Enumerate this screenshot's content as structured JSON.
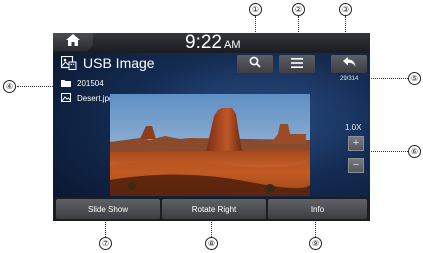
{
  "status_bar": {
    "time": "9:22",
    "ampm": "AM"
  },
  "header": {
    "title": "USB Image",
    "photo_count": "29/314"
  },
  "files": [
    {
      "type": "folder",
      "name": "201504"
    },
    {
      "type": "image",
      "name": "Desert.jpg"
    }
  ],
  "zoom": {
    "level": "1.0X",
    "plus": "+",
    "minus": "−"
  },
  "bottom_buttons": [
    {
      "label": "Slide Show"
    },
    {
      "label": "Rotate Right"
    },
    {
      "label": "Info"
    }
  ],
  "callouts": [
    "①",
    "②",
    "③",
    "④",
    "⑤",
    "⑥",
    "⑦",
    "⑧",
    "⑨"
  ],
  "icons": {
    "home": "home-icon",
    "usb": "usb-image-icon",
    "search": "search-icon",
    "menu": "menu-icon",
    "back": "back-arrow-icon",
    "folder": "folder-icon",
    "image": "image-file-icon"
  },
  "colors": {
    "background": "#142b52",
    "button": "#4c4e54",
    "text": "#ffffff"
  }
}
